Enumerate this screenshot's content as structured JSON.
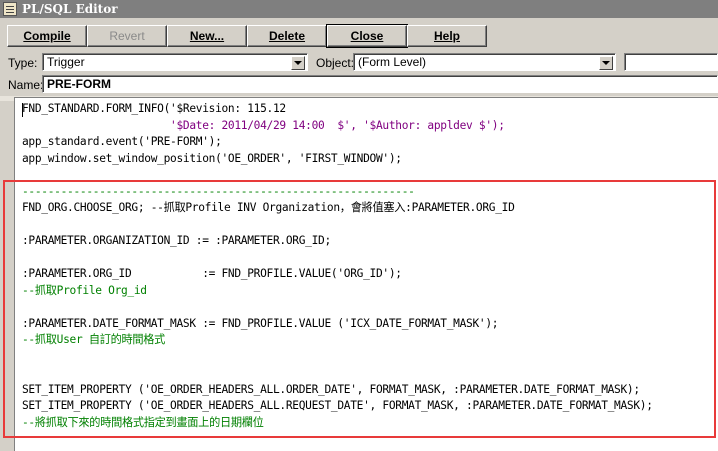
{
  "window": {
    "title": "PL/SQL Editor"
  },
  "toolbar": {
    "compile": "Compile",
    "revert": "Revert",
    "new": "New...",
    "delete": "Delete",
    "close": "Close",
    "help": "Help"
  },
  "type": {
    "label": "Type:",
    "value": "Trigger"
  },
  "object": {
    "label": "Object:",
    "value": "(Form Level)"
  },
  "name": {
    "label": "Name:",
    "value": "PRE-FORM"
  },
  "code": {
    "lines": [
      "FND_STANDARD.FORM_INFO('$Revision: 115.12",
      "                       '$Date: 2011/04/29 14:00  $', '$Author: appldev $');",
      "app_standard.event('PRE-FORM');",
      "app_window.set_window_position('OE_ORDER', 'FIRST_WINDOW');",
      "",
      "-------------------------------------------------------------",
      "FND_ORG.CHOOSE_ORG; --抓取Profile INV Organization，會將值塞入:PARAMETER.ORG_ID",
      "",
      ":PARAMETER.ORGANIZATION_ID := :PARAMETER.ORG_ID;",
      "",
      ":PARAMETER.ORG_ID           := FND_PROFILE.VALUE('ORG_ID');",
      "--抓取Profile Org_id",
      "",
      ":PARAMETER.DATE_FORMAT_MASK := FND_PROFILE.VALUE ('ICX_DATE_FORMAT_MASK');",
      "--抓取User 自訂的時間格式",
      "",
      "",
      "SET_ITEM_PROPERTY ('OE_ORDER_HEADERS_ALL.ORDER_DATE', FORMAT_MASK, :PARAMETER.DATE_FORMAT_MASK);",
      "SET_ITEM_PROPERTY ('OE_ORDER_HEADERS_ALL.REQUEST_DATE', FORMAT_MASK, :PARAMETER.DATE_FORMAT_MASK);",
      "--將抓取下來的時間格式指定到畫面上的日期欄位"
    ]
  },
  "colors": {
    "string": "#800080",
    "keyword": "#0000c8",
    "comment": "#008000",
    "highlight_box": "#e83a3a"
  }
}
